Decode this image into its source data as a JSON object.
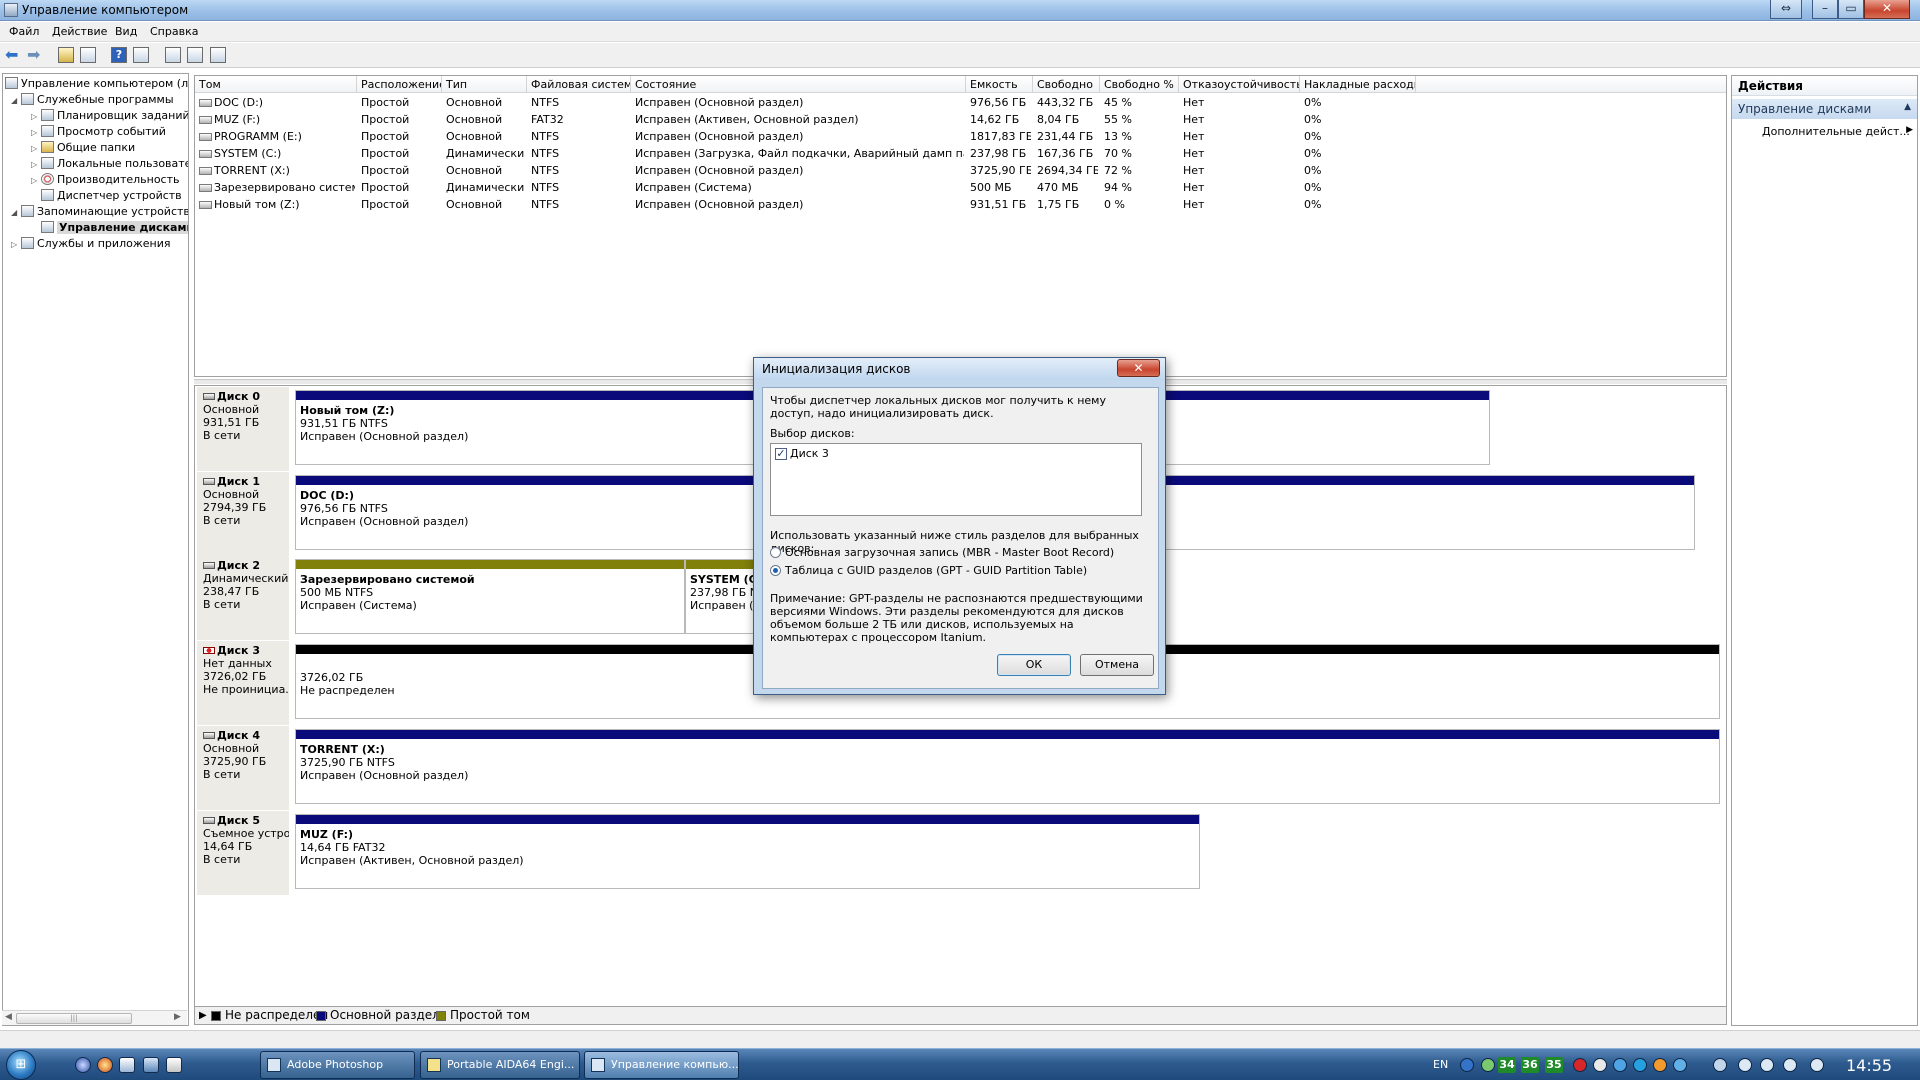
{
  "window": {
    "title": "Управление компьютером"
  },
  "menu": [
    "Файл",
    "Действие",
    "Вид",
    "Справка"
  ],
  "tree": {
    "items": [
      {
        "label": "Управление компьютером (лока",
        "indent": 0,
        "expander": ""
      },
      {
        "label": "Служебные программы",
        "indent": 1,
        "expander": "◢"
      },
      {
        "label": "Планировщик заданий",
        "indent": 2,
        "expander": "▷"
      },
      {
        "label": "Просмотр событий",
        "indent": 2,
        "expander": "▷"
      },
      {
        "label": "Общие папки",
        "indent": 2,
        "expander": "▷"
      },
      {
        "label": "Локальные пользовател",
        "indent": 2,
        "expander": "▷"
      },
      {
        "label": "Производительность",
        "indent": 2,
        "expander": "▷"
      },
      {
        "label": "Диспетчер устройств",
        "indent": 2,
        "expander": ""
      },
      {
        "label": "Запоминающие устройства",
        "indent": 1,
        "expander": "◢"
      },
      {
        "label": "Управление дисками",
        "indent": 2,
        "expander": ""
      },
      {
        "label": "Службы и приложения",
        "indent": 1,
        "expander": "▷"
      }
    ]
  },
  "volumes": {
    "headers": [
      "Том",
      "Расположение",
      "Тип",
      "Файловая система",
      "Состояние",
      "Емкость",
      "Свободно",
      "Свободно %",
      "Отказоустойчивость",
      "Накладные расходы"
    ],
    "rows": [
      [
        "DOC (D:)",
        "Простой",
        "Основной",
        "NTFS",
        "Исправен (Основной раздел)",
        "976,56 ГБ",
        "443,32 ГБ",
        "45 %",
        "Нет",
        "0%"
      ],
      [
        "MUZ (F:)",
        "Простой",
        "Основной",
        "FAT32",
        "Исправен (Активен, Основной раздел)",
        "14,62 ГБ",
        "8,04 ГБ",
        "55 %",
        "Нет",
        "0%"
      ],
      [
        "PROGRAMM (E:)",
        "Простой",
        "Основной",
        "NTFS",
        "Исправен (Основной раздел)",
        "1817,83 ГБ",
        "231,44 ГБ",
        "13 %",
        "Нет",
        "0%"
      ],
      [
        "SYSTEM (C:)",
        "Простой",
        "Динамический",
        "NTFS",
        "Исправен (Загрузка, Файл подкачки, Аварийный дамп памяти)",
        "237,98 ГБ",
        "167,36 ГБ",
        "70 %",
        "Нет",
        "0%"
      ],
      [
        "TORRENT (X:)",
        "Простой",
        "Основной",
        "NTFS",
        "Исправен (Основной раздел)",
        "3725,90 ГБ",
        "2694,34 ГБ",
        "72 %",
        "Нет",
        "0%"
      ],
      [
        "Зарезервировано системой",
        "Простой",
        "Динамический",
        "NTFS",
        "Исправен (Система)",
        "500 МБ",
        "470 МБ",
        "94 %",
        "Нет",
        "0%"
      ],
      [
        "Новый том (Z:)",
        "Простой",
        "Основной",
        "NTFS",
        "Исправен (Основной раздел)",
        "931,51 ГБ",
        "1,75 ГБ",
        "0 %",
        "Нет",
        "0%"
      ]
    ]
  },
  "disks": [
    {
      "name": "Диск 0",
      "lines": [
        "Основной",
        "931,51 ГБ",
        "В сети"
      ],
      "warn": false,
      "partitions": [
        {
          "name": "Новый том  (Z:)",
          "line1": "931,51 ГБ NTFS",
          "line2": "Исправен (Основной раздел)",
          "kind": "primary"
        }
      ]
    },
    {
      "name": "Диск 1",
      "lines": [
        "Основной",
        "2794,39 ГБ",
        "В сети"
      ],
      "warn": false,
      "partitions": [
        {
          "name": "DOC  (D:)",
          "line1": "976,56 ГБ NTFS",
          "line2": "Исправен (Основной раздел)",
          "kind": "primary"
        }
      ]
    },
    {
      "name": "Диск 2",
      "lines": [
        "Динамический",
        "238,47 ГБ",
        "В сети"
      ],
      "warn": false,
      "partitions": [
        {
          "name": "Зарезервировано системой",
          "line1": "500 МБ NTFS",
          "line2": "Исправен (Система)",
          "kind": "simple"
        },
        {
          "name": "SYSTEM  (C:)",
          "line1": "237,98 ГБ NTFS",
          "line2": "Исправен (З",
          "kind": "simple"
        }
      ]
    },
    {
      "name": "Диск 3",
      "lines": [
        "Нет данных",
        "3726,02 ГБ",
        "Не проинициа..."
      ],
      "warn": true,
      "partitions": [
        {
          "name": "",
          "line1": "3726,02 ГБ",
          "line2": "Не распределен",
          "kind": "unallocated"
        }
      ]
    },
    {
      "name": "Диск 4",
      "lines": [
        "Основной",
        "3725,90 ГБ",
        "В сети"
      ],
      "warn": false,
      "partitions": [
        {
          "name": "TORRENT  (X:)",
          "line1": "3725,90 ГБ NTFS",
          "line2": "Исправен (Основной раздел)",
          "kind": "primary"
        }
      ]
    },
    {
      "name": "Диск 5",
      "lines": [
        "Съемное устрой",
        "14,64 ГБ",
        "В сети"
      ],
      "warn": false,
      "partitions": [
        {
          "name": "MUZ  (F:)",
          "line1": "14,64 ГБ FAT32",
          "line2": "Исправен (Активен, Основной раздел)",
          "kind": "primary"
        }
      ]
    }
  ],
  "legend": [
    {
      "label": "Не распределен",
      "color": "#000000"
    },
    {
      "label": "Основной раздел",
      "color": "#0a0a7a"
    },
    {
      "label": "Простой том",
      "color": "#80800a"
    }
  ],
  "actions": {
    "title": "Действия",
    "section": "Управление дисками",
    "item": "Дополнительные дейст..."
  },
  "dialog": {
    "title": "Инициализация дисков",
    "intro": "Чтобы диспетчер локальных дисков мог получить к нему доступ, надо инициализировать диск.",
    "select_label": "Выбор дисков:",
    "disk_item": "Диск 3",
    "disk_checked": true,
    "style_label": "Использовать указанный ниже стиль разделов для выбранных дисков:",
    "option_mbr": "Основная загрузочная запись (MBR - Master Boot Record)",
    "option_gpt": "Таблица с GUID разделов (GPT - GUID Partition Table)",
    "selected_option": "gpt",
    "note": "Примечание: GPT-разделы не распознаются предшествующими версиями Windows. Эти разделы рекомендуются для дисков объемом больше 2 ТБ или дисков, используемых на компьютерах с процессором Itanium.",
    "ok": "ОК",
    "cancel": "Отмена"
  },
  "taskbar": {
    "tasks": [
      {
        "label": "Adobe Photoshop",
        "active": false
      },
      {
        "label": "Portable AIDA64 Engi...",
        "active": false
      },
      {
        "label": "Управление компью...",
        "active": true
      }
    ],
    "lang": "EN",
    "badges": [
      "34",
      "36",
      "35"
    ],
    "clock": "14:55"
  },
  "colors": {
    "primary_partition": "#0a0a7a",
    "simple_volume": "#80800a",
    "unallocated": "#000000"
  }
}
